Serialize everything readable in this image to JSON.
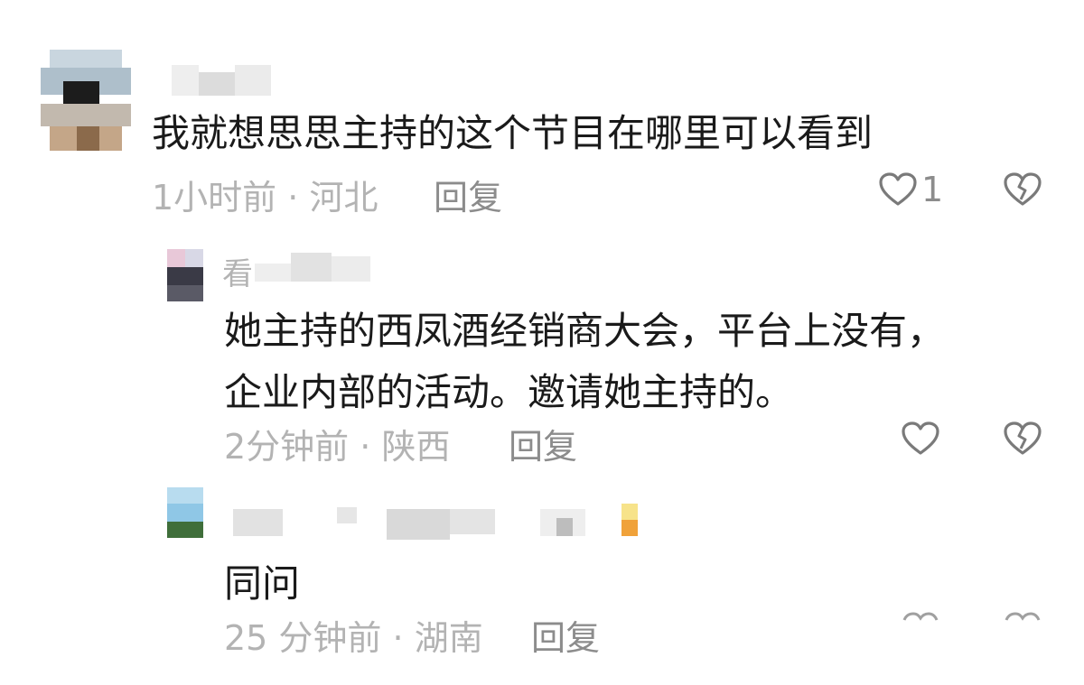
{
  "comments": [
    {
      "text": "我就想思思主持的这个节目在哪里可以看到",
      "time": "1小时前",
      "location": "河北",
      "reply_label": "回复",
      "like_count": "1"
    },
    {
      "name_visible": "看",
      "text_line1": "她主持的西凤酒经销商大会，平台上没有，",
      "text_line2": "企业内部的活动。邀请她主持的。",
      "time": "2分钟前",
      "location": "陕西",
      "reply_label": "回复"
    },
    {
      "text": "同问",
      "time": "25 分钟前",
      "location": "湖南",
      "reply_label": "回复"
    }
  ],
  "meta_separator": " · ",
  "icons": {
    "like": "heart-outline-icon",
    "dislike": "broken-heart-icon"
  },
  "colors": {
    "text": "#1a1a1a",
    "meta": "#b3b3b3",
    "reply": "#8c8c8c",
    "icon": "#7a7a7a"
  }
}
